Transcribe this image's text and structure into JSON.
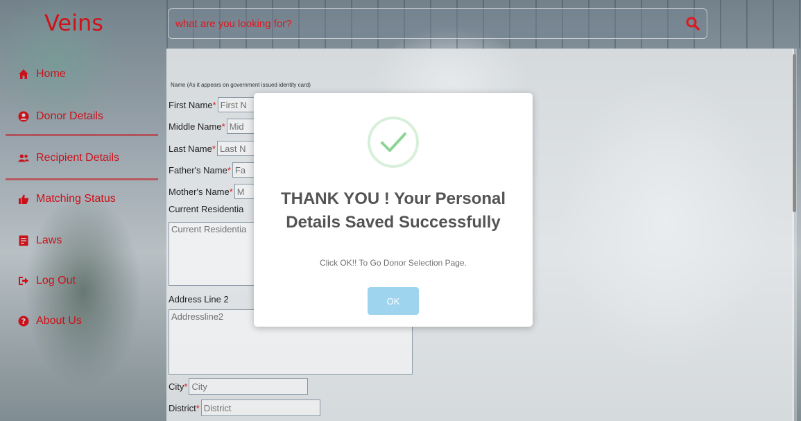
{
  "brand": "Veins",
  "search": {
    "placeholder": "what are you looking for?"
  },
  "sidebar": {
    "items": [
      {
        "label": "Home",
        "icon": "home-icon"
      },
      {
        "label": "Donor Details",
        "icon": "user-circle-icon"
      },
      {
        "label": "Recipient Details",
        "icon": "users-icon"
      },
      {
        "label": "Matching Status",
        "icon": "thumbs-up-icon"
      },
      {
        "label": "Laws",
        "icon": "document-icon"
      },
      {
        "label": "Log Out",
        "icon": "sign-out-icon"
      },
      {
        "label": "About Us",
        "icon": "question-circle-icon"
      }
    ]
  },
  "form": {
    "note": "Name (As it appears on government issued identity card)",
    "first_name": {
      "label": "First Name",
      "placeholder": "First N"
    },
    "middle_name": {
      "label": "Middle Name",
      "placeholder": "Mid"
    },
    "last_name": {
      "label": "Last Name",
      "placeholder": "Last N"
    },
    "father_name": {
      "label": "Father's Name",
      "placeholder": "Fa"
    },
    "mother_name": {
      "label": "Mother's Name",
      "placeholder": "M"
    },
    "current_residential": {
      "label": "Current Residentia",
      "placeholder": "Current Residentia"
    },
    "address_line2": {
      "label": "Address Line 2",
      "placeholder": "Addressline2"
    },
    "city": {
      "label": "City",
      "placeholder": "City"
    },
    "district": {
      "label": "District",
      "placeholder": "District"
    }
  },
  "modal": {
    "title_line1": "THANK YOU ! Your Personal",
    "title_line2": "Details Saved Successfully",
    "text": "Click OK!! To Go Donor Selection Page.",
    "ok_label": "OK"
  },
  "colors": {
    "accent_red": "#d3141a",
    "ok_button": "#9fd4ef",
    "success_green": "#8cd496"
  }
}
